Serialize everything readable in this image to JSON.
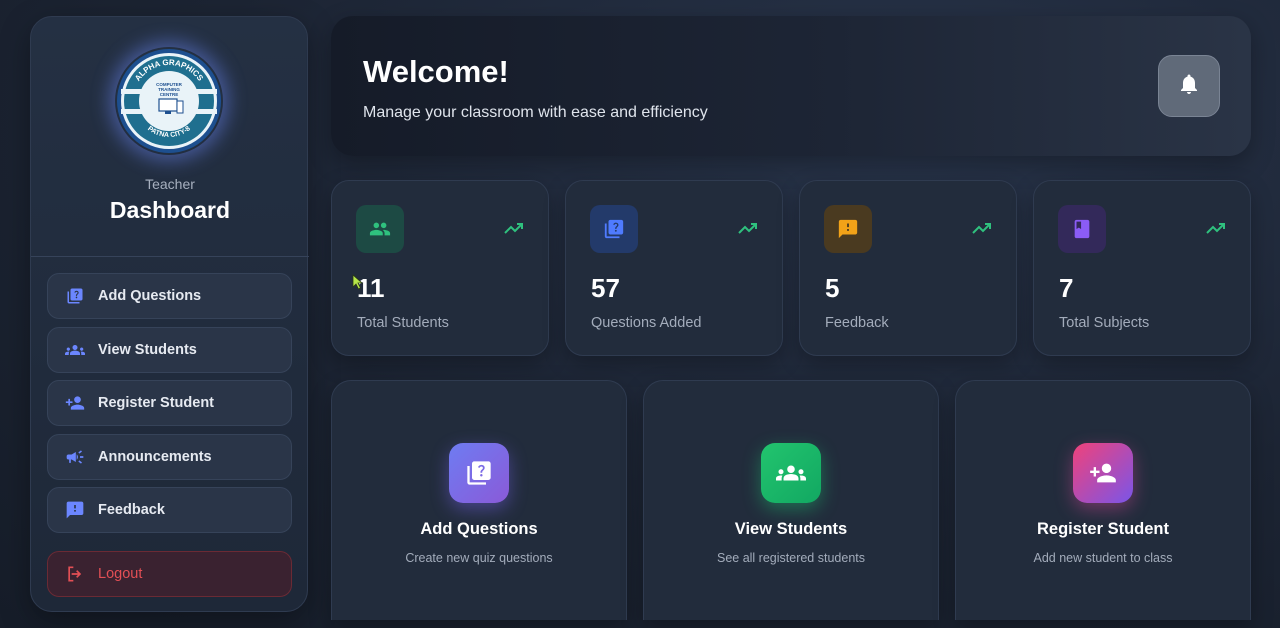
{
  "sidebar": {
    "teacher_label": "Teacher",
    "title": "Dashboard",
    "logo": {
      "top_text": "ALPHA GRAPHICS",
      "inner_text": "COMPUTER TRAINING CENTRE",
      "tagline": "Your Trust is our Success",
      "bottom_text": "PATNA CITY-8"
    },
    "items": [
      {
        "label": "Add Questions",
        "icon": "quiz-icon"
      },
      {
        "label": "View Students",
        "icon": "group-icon"
      },
      {
        "label": "Register Student",
        "icon": "person-add-icon"
      },
      {
        "label": "Announcements",
        "icon": "megaphone-icon"
      },
      {
        "label": "Feedback",
        "icon": "feedback-icon"
      }
    ],
    "logout_label": "Logout"
  },
  "welcome": {
    "title": "Welcome!",
    "subtitle": "Manage your classroom with ease and efficiency"
  },
  "stats": [
    {
      "value": "11",
      "label": "Total Students",
      "icon": "group-icon",
      "color": "#2fc17e"
    },
    {
      "value": "57",
      "label": "Questions Added",
      "icon": "quiz-icon",
      "color": "#4f7bff"
    },
    {
      "value": "5",
      "label": "Feedback",
      "icon": "feedback-icon",
      "color": "#f2a218"
    },
    {
      "value": "7",
      "label": "Total Subjects",
      "icon": "book-icon",
      "color": "#8b5cf6"
    }
  ],
  "actions": [
    {
      "title": "Add Questions",
      "desc": "Create new quiz questions",
      "icon": "quiz-icon"
    },
    {
      "title": "View Students",
      "desc": "See all registered students",
      "icon": "group-icon"
    },
    {
      "title": "Register Student",
      "desc": "Add new student to class",
      "icon": "person-add-icon"
    }
  ],
  "colors": {
    "accent_blue": "#6b86ff",
    "trend_green": "#2fc17e",
    "logout_red": "#e34f55"
  }
}
